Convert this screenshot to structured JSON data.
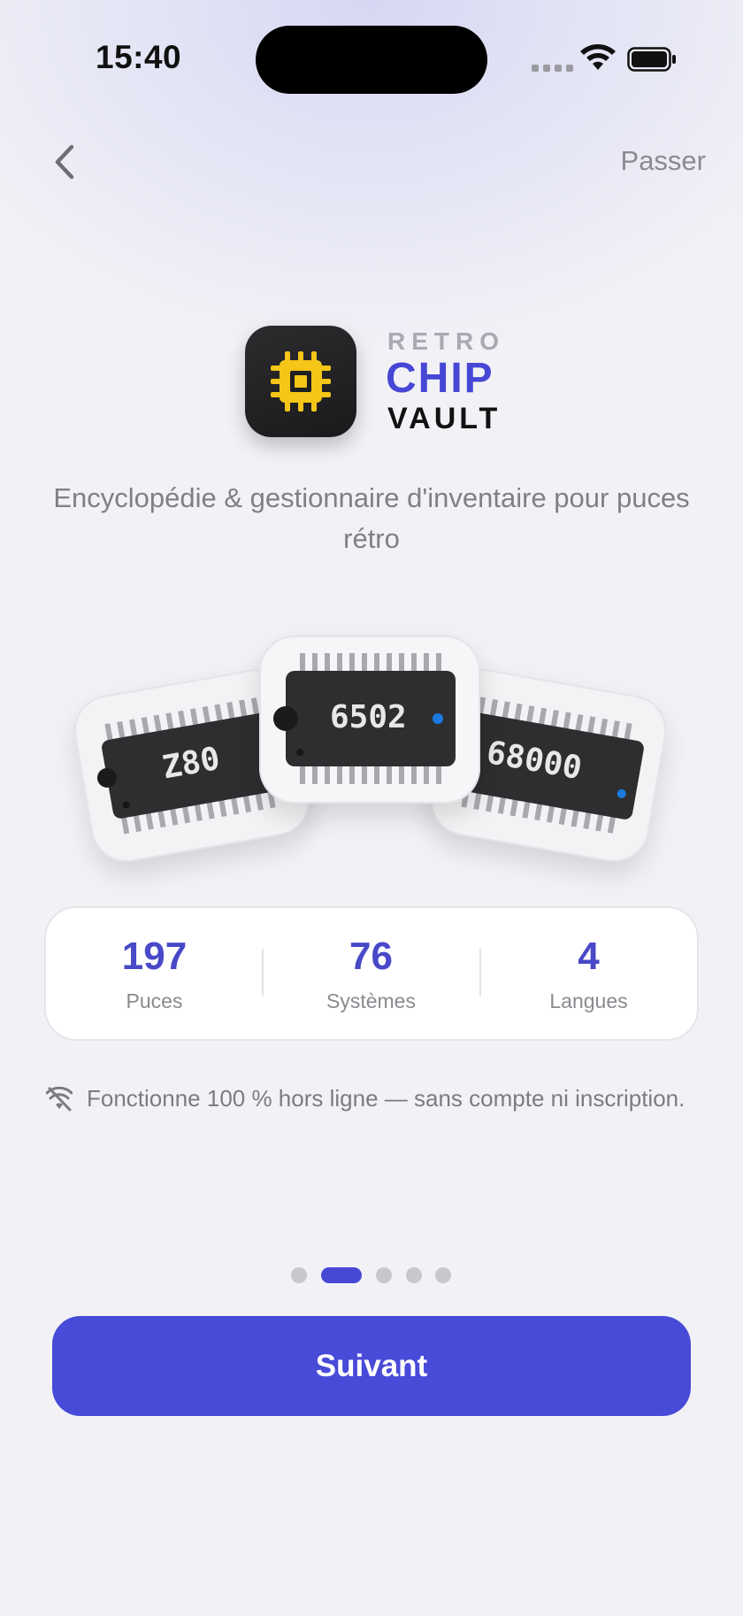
{
  "status_bar": {
    "time": "15:40"
  },
  "nav": {
    "skip_label": "Passer"
  },
  "brand": {
    "line1": "RETRO",
    "line2": "CHIP",
    "line3": "VAULT",
    "accent": "#4747d6"
  },
  "tagline": "Encyclopédie & gestionnaire d'inventaire pour puces rétro",
  "chips": [
    {
      "label": "Z80"
    },
    {
      "label": "6502"
    },
    {
      "label": "68000"
    }
  ],
  "stats": [
    {
      "value": "197",
      "label": "Puces"
    },
    {
      "value": "76",
      "label": "Systèmes"
    },
    {
      "value": "4",
      "label": "Langues"
    }
  ],
  "offline_note": "Fonctionne 100 % hors ligne — sans compte ni inscription.",
  "pagination": {
    "total": 5,
    "current": 2
  },
  "primary_button": {
    "label": "Suivant",
    "color": "#484bd8"
  },
  "icons": [
    "back-chevron-icon",
    "wifi-icon",
    "battery-icon",
    "chip-icon",
    "wifi-off-icon"
  ]
}
